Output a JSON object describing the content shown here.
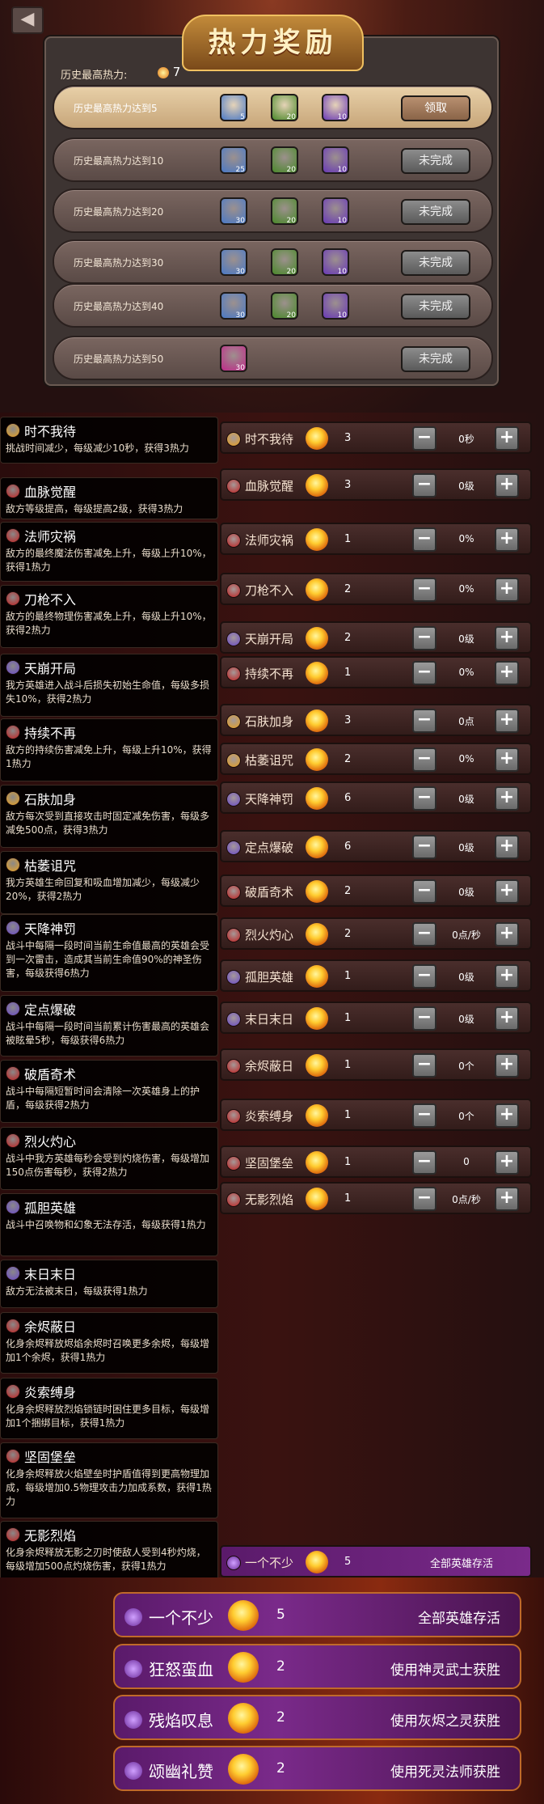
{
  "header": {
    "back_icon": "back-arrow-icon",
    "title": "热力奖励"
  },
  "history": {
    "label": "历史最高热力:",
    "value": "7"
  },
  "rewards": [
    {
      "label": "历史最高热力达到5",
      "items": [
        {
          "color": "#4a7ac8",
          "count": "5"
        },
        {
          "color": "#4a8a2a",
          "count": "20"
        },
        {
          "color": "#6a3ab8",
          "count": "10"
        }
      ],
      "button": "领取",
      "state": "claim"
    },
    {
      "label": "历史最高热力达到10",
      "items": [
        {
          "color": "#4a7ac8",
          "count": "25"
        },
        {
          "color": "#4a8a2a",
          "count": "20"
        },
        {
          "color": "#6a3ab8",
          "count": "10"
        }
      ],
      "button": "未完成",
      "state": "todo"
    },
    {
      "label": "历史最高热力达到20",
      "items": [
        {
          "color": "#4a7ac8",
          "count": "30"
        },
        {
          "color": "#4a8a2a",
          "count": "20"
        },
        {
          "color": "#6a3ab8",
          "count": "10"
        }
      ],
      "button": "未完成",
      "state": "todo"
    },
    {
      "label": "历史最高热力达到30",
      "items": [
        {
          "color": "#4a7ac8",
          "count": "30"
        },
        {
          "color": "#4a8a2a",
          "count": "20"
        },
        {
          "color": "#6a3ab8",
          "count": "10"
        }
      ],
      "button": "未完成",
      "state": "todo"
    },
    {
      "label": "历史最高热力达到40",
      "items": [
        {
          "color": "#4a7ac8",
          "count": "30"
        },
        {
          "color": "#4a8a2a",
          "count": "20"
        },
        {
          "color": "#6a3ab8",
          "count": "10"
        }
      ],
      "button": "未完成",
      "state": "todo"
    },
    {
      "label": "历史最高热力达到50",
      "items": [
        {
          "color": "#c02a8a",
          "count": "30"
        }
      ],
      "button": "未完成",
      "state": "todo"
    }
  ],
  "talents": [
    {
      "name": "时不我待",
      "icon_color": "#e8a020",
      "desc": "挑战时间减少，每级减少10秒，获得3热力",
      "cost": "3",
      "level": "0秒"
    },
    {
      "name": "血脉觉醒",
      "icon_color": "#c02020",
      "desc": "敌方等级提高，每级提高2级，获得3热力",
      "cost": "3",
      "level": "0级"
    },
    {
      "name": "法师灾祸",
      "icon_color": "#c02020",
      "desc": "敌方的最终魔法伤害减免上升，每级上升10%，获得1热力",
      "cost": "1",
      "level": "0%"
    },
    {
      "name": "刀枪不入",
      "icon_color": "#c02020",
      "desc": "敌方的最终物理伤害减免上升，每级上升10%，获得2热力",
      "cost": "2",
      "level": "0%"
    },
    {
      "name": "天崩开局",
      "icon_color": "#6a4ac8",
      "desc": "我方英雄进入战斗后损失初始生命值，每级多损失10%，获得2热力",
      "cost": "2",
      "level": "0级"
    },
    {
      "name": "持续不再",
      "icon_color": "#c02020",
      "desc": "敌方的持续伤害减免上升，每级上升10%，获得1热力",
      "cost": "1",
      "level": "0%"
    },
    {
      "name": "石肤加身",
      "icon_color": "#e8a020",
      "desc": "敌方每次受到直接攻击时固定减免伤害，每级多减免500点，获得3热力",
      "cost": "3",
      "level": "0点"
    },
    {
      "name": "枯萎诅咒",
      "icon_color": "#e8a020",
      "desc": "我方英雄生命回复和吸血增加减少，每级减少20%，获得2热力",
      "cost": "2",
      "level": "0%"
    },
    {
      "name": "天降神罚",
      "icon_color": "#6a4ac8",
      "desc": "战斗中每隔一段时间当前生命值最高的英雄会受到一次雷击，造成其当前生命值90%的神圣伤害，每级获得6热力",
      "cost": "6",
      "level": "0级"
    },
    {
      "name": "定点爆破",
      "icon_color": "#6a4ac8",
      "desc": "战斗中每隔一段时间当前累计伤害最高的英雄会被眩晕5秒，每级获得6热力",
      "cost": "6",
      "level": "0级"
    },
    {
      "name": "破盾奇术",
      "icon_color": "#c02020",
      "desc": "战斗中每隔短暂时间会清除一次英雄身上的护盾，每级获得2热力",
      "cost": "2",
      "level": "0级"
    },
    {
      "name": "烈火灼心",
      "icon_color": "#c02020",
      "desc": "战斗中我方英雄每秒会受到灼烧伤害，每级增加150点伤害每秒，获得2热力",
      "cost": "2",
      "level": "0点/秒"
    },
    {
      "name": "孤胆英雄",
      "icon_color": "#6a4ac8",
      "desc": "战斗中召唤物和幻象无法存活，每级获得1热力",
      "cost": "1",
      "level": "0级"
    },
    {
      "name": "末日末日",
      "icon_color": "#6a4ac8",
      "desc": "敌方无法被末日，每级获得1热力",
      "cost": "1",
      "level": "0级"
    },
    {
      "name": "余烬蔽日",
      "icon_color": "#c02020",
      "desc": "化身余烬释放烬焰余烬时召唤更多余烬，每级增加1个余烬，获得1热力",
      "cost": "1",
      "level": "0个"
    },
    {
      "name": "炎索缚身",
      "icon_color": "#c02020",
      "desc": "化身余烬释放烈焰锁链时困住更多目标，每级增加1个捆绑目标，获得1热力",
      "cost": "1",
      "level": "0个"
    },
    {
      "name": "坚固堡垒",
      "icon_color": "#c02020",
      "desc": "化身余烬释放火焰壁垒时护盾值得到更高物理加成，每级增加0.5物理攻击力加成系数，获得1热力",
      "cost": "1",
      "level": "0"
    },
    {
      "name": "无影烈焰",
      "icon_color": "#c02020",
      "desc": "化身余烬释放无影之刃时使敌人受到4秒灼烧，每级增加500点灼烧伤害，获得1热力",
      "cost": "1",
      "level": "0点/秒"
    }
  ],
  "small_achievement": {
    "name": "一个不少",
    "cost": "5",
    "condition": "全部英雄存活"
  },
  "achievements": [
    {
      "name": "一个不少",
      "cost": "5",
      "condition": "全部英雄存活"
    },
    {
      "name": "狂怒蛮血",
      "cost": "2",
      "condition": "使用神灵武士获胜"
    },
    {
      "name": "残焰叹息",
      "cost": "2",
      "condition": "使用灰烬之灵获胜"
    },
    {
      "name": "颂幽礼赞",
      "cost": "2",
      "condition": "使用死灵法师获胜"
    }
  ]
}
